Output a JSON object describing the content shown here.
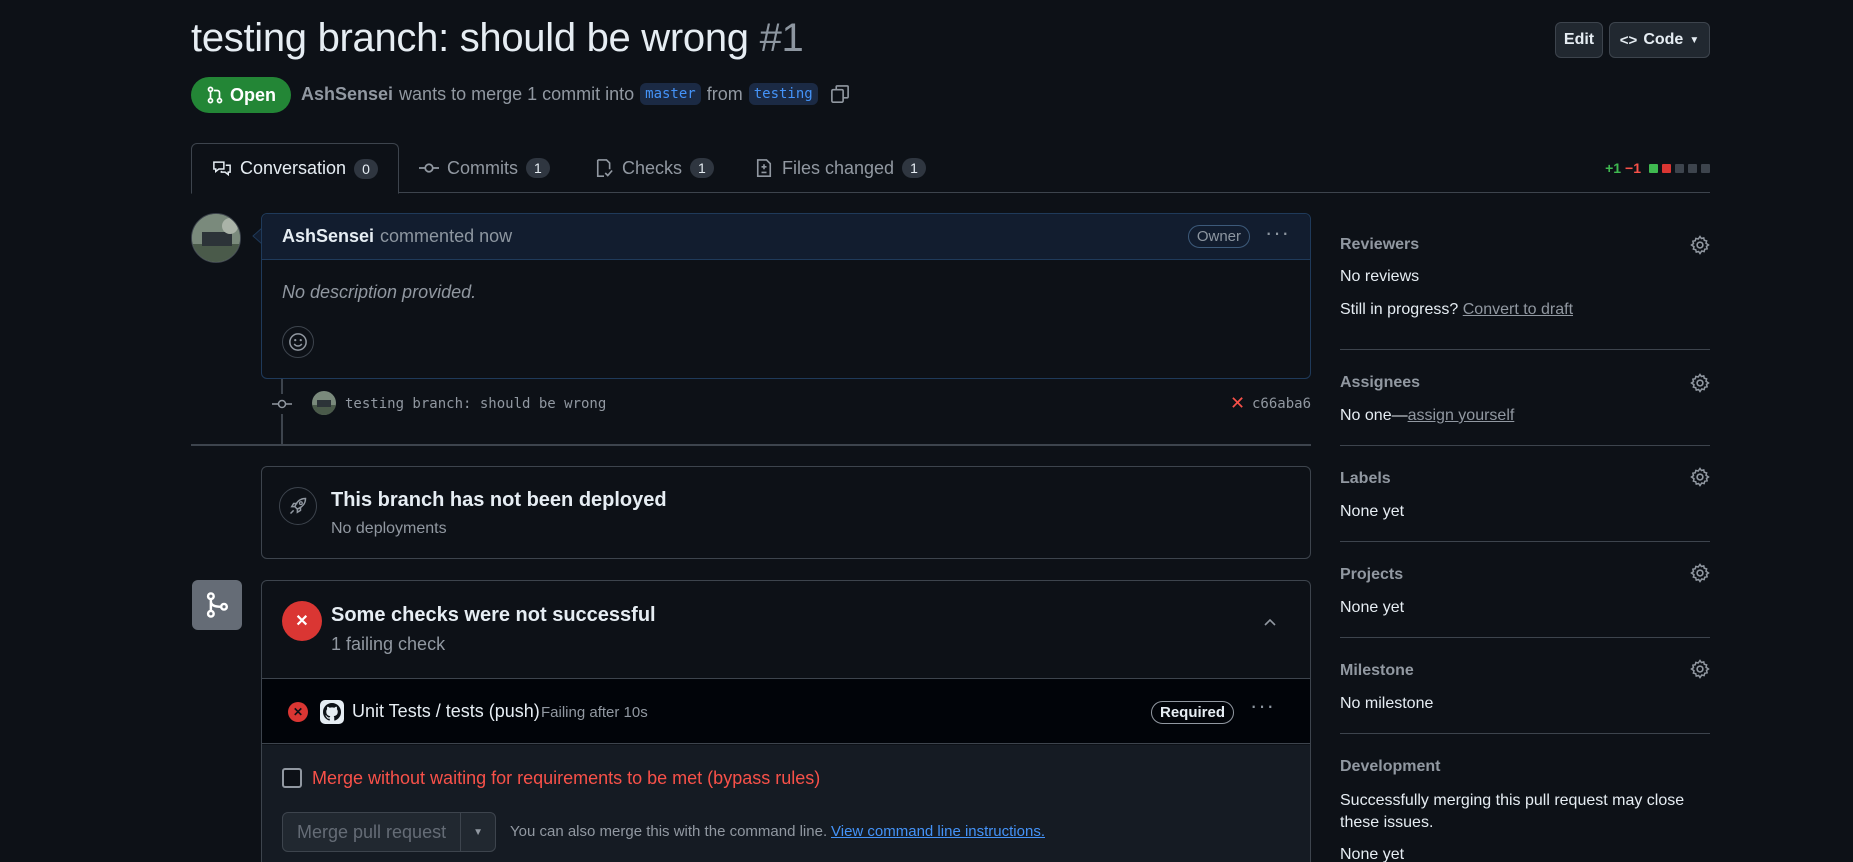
{
  "header": {
    "title": "testing branch: should be wrong",
    "number": "#1",
    "edit_label": "Edit",
    "code_label": "Code",
    "state": "Open",
    "author": "AshSensei",
    "merge_text_1": "wants to merge 1 commit into",
    "base_branch": "master",
    "merge_text_2": "from",
    "head_branch": "testing"
  },
  "tabs": [
    {
      "label": "Conversation",
      "count": "0"
    },
    {
      "label": "Commits",
      "count": "1"
    },
    {
      "label": "Checks",
      "count": "1"
    },
    {
      "label": "Files changed",
      "count": "1"
    }
  ],
  "diffstat": {
    "additions": "+1",
    "deletions": "−1"
  },
  "comment": {
    "author": "AshSensei",
    "action": "commented now",
    "badge": "Owner",
    "body": "No description provided."
  },
  "commit": {
    "message": "testing branch: should be wrong",
    "sha": "c66aba6"
  },
  "deploy": {
    "title": "This branch has not been deployed",
    "subtitle": "No deployments"
  },
  "checks": {
    "title": "Some checks were not successful",
    "subtitle": "1 failing check",
    "row_name": "Unit Tests / tests (push)",
    "row_status": "Failing after 10s",
    "row_badge": "Required",
    "bypass_label": "Merge without waiting for requirements to be met (bypass rules)",
    "merge_button": "Merge pull request",
    "cli_text": "You can also merge this with the command line.",
    "cli_link": "View command line instructions."
  },
  "sidebar": {
    "reviewers_h": "Reviewers",
    "reviewers_v": "No reviews",
    "progress_text": "Still in progress?",
    "progress_link": "Convert to draft",
    "assignees_h": "Assignees",
    "assignees_v": "No one—",
    "assignees_link": "assign yourself",
    "labels_h": "Labels",
    "labels_v": "None yet",
    "projects_h": "Projects",
    "projects_v": "None yet",
    "milestone_h": "Milestone",
    "milestone_v": "No milestone",
    "development_h": "Development",
    "development_v": "Successfully merging this pull request may close these issues.",
    "development_v2": "None yet"
  },
  "colors": {
    "accent": "#4493f8",
    "open": "#238636",
    "danger": "#da3633",
    "bypass_text": "#f85149"
  }
}
